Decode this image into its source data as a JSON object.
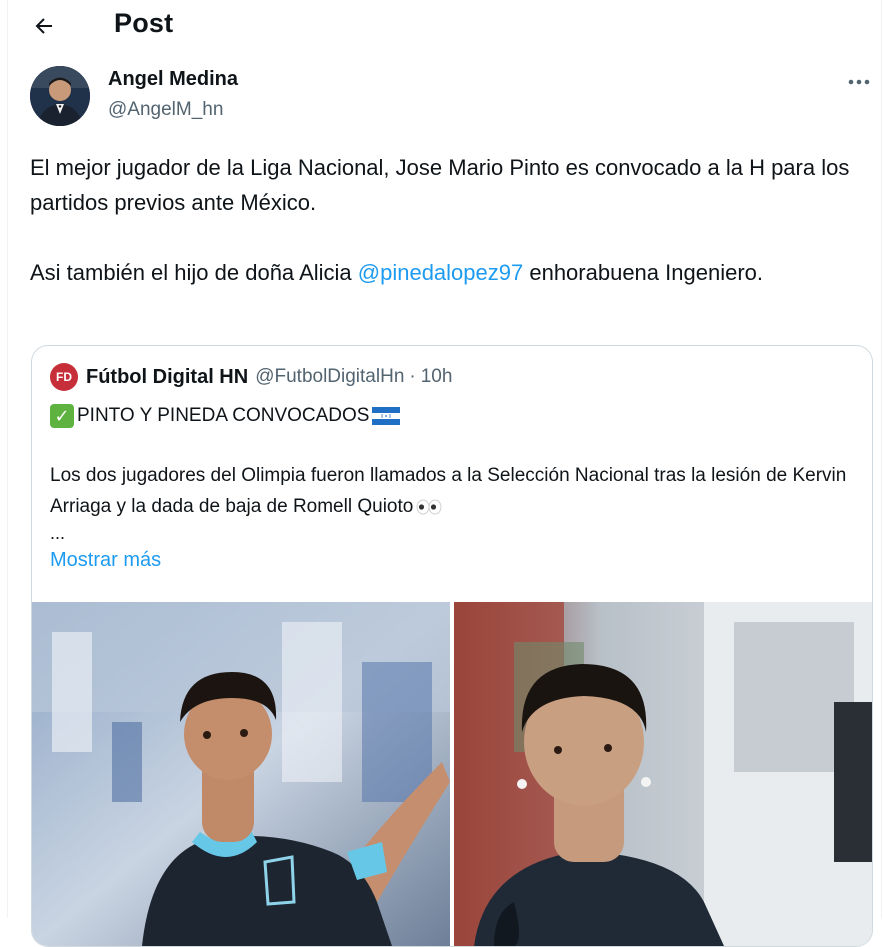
{
  "header": {
    "title": "Post"
  },
  "author": {
    "name": "Angel Medina",
    "handle": "@AngelM_hn"
  },
  "tweet": {
    "line1": "El mejor jugador de la Liga Nacional,  Jose Mario Pinto es convocado a la H para los partidos previos ante México.",
    "line2_before": "Asi también el hijo de doña Alicia ",
    "mention": "@pinedalopez97",
    "line2_after": " enhorabuena Ingeniero."
  },
  "quote": {
    "logo_text": "FD",
    "name": "Fútbol Digital HN",
    "handle": "@FutbolDigitalHn",
    "separator": "·",
    "time": "10h",
    "headline": "PINTO Y PINEDA CONVOCADOS",
    "body": "Los dos jugadores del Olimpia fueron llamados a la Selección Nacional tras la lesión de Kervin Arriaga y la dada de baja de Romell Quioto",
    "ellipsis": "...",
    "show_more": "Mostrar más"
  },
  "colors": {
    "link": "#1d9bf0",
    "text": "#0f1419",
    "secondary": "#536471",
    "border": "#cfd9de"
  },
  "icons": {
    "back": "arrow-left-icon",
    "more": "more-horizontal-icon",
    "check": "check-mark-icon",
    "flag": "honduras-flag-icon",
    "eyes": "eyes-icon"
  }
}
